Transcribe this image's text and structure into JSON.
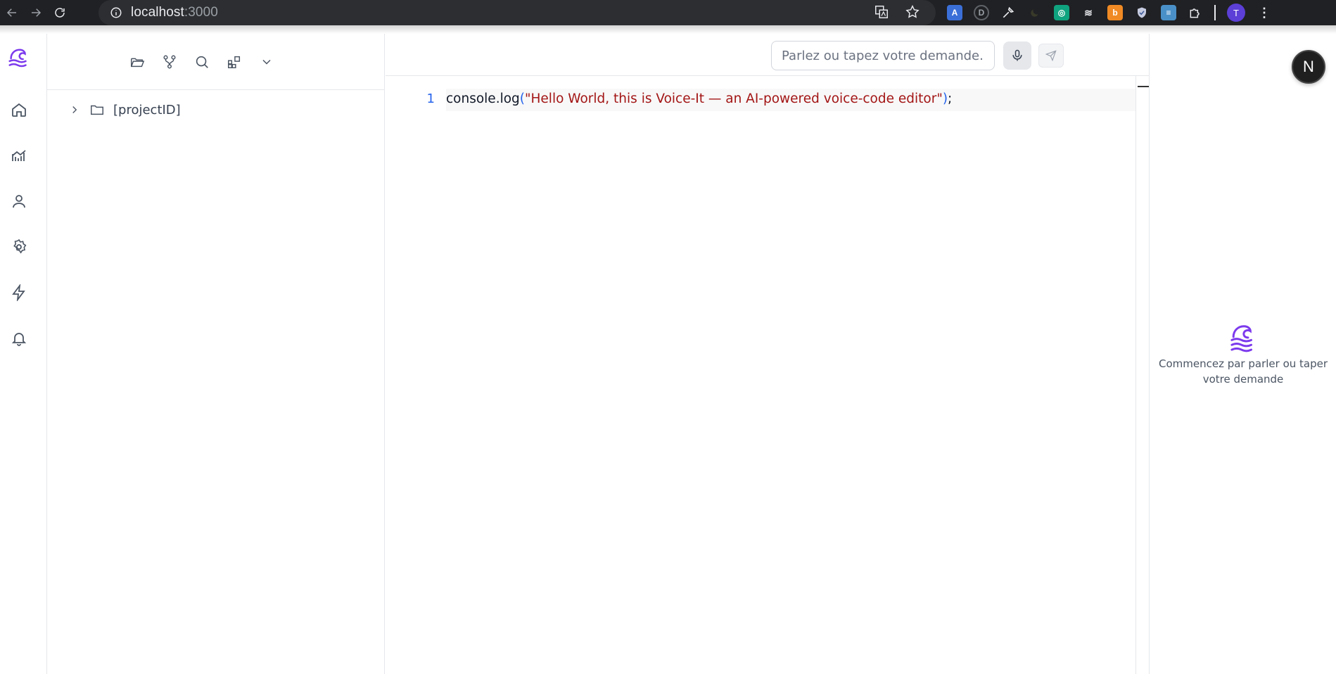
{
  "browser": {
    "url_host": "localhost",
    "url_port": ":3000",
    "profile_initial": "T"
  },
  "explorer": {
    "tree_root_label": "[projectID]"
  },
  "command_bar": {
    "placeholder": "Parlez ou tapez votre demande..."
  },
  "editor": {
    "line_number": "1",
    "code_ident": "console.log",
    "code_open": "(",
    "code_string": "\"Hello World, this is Voice-It — an AI-powered voice-code editor\"",
    "code_close": ")",
    "code_semi": ";"
  },
  "assistant": {
    "empty_line1": "Commencez par parler ou taper",
    "empty_line2": "votre demande"
  },
  "badge": {
    "label": "N"
  },
  "colors": {
    "brand": "#7c3aed",
    "string": "#a31515",
    "line_number": "#2563eb"
  }
}
